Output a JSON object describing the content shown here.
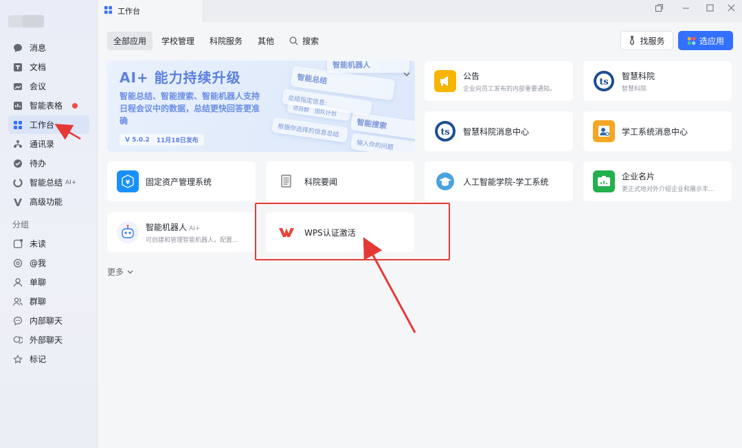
{
  "window": {
    "title": "工作台"
  },
  "sidebar": {
    "items": [
      {
        "label": "消息",
        "icon": "message-icon"
      },
      {
        "label": "文档",
        "icon": "doc-icon"
      },
      {
        "label": "会议",
        "icon": "meeting-icon"
      },
      {
        "label": "智能表格",
        "icon": "table-icon"
      },
      {
        "label": "工作台",
        "icon": "workbench-icon"
      },
      {
        "label": "通讯录",
        "icon": "contacts-icon"
      },
      {
        "label": "待办",
        "icon": "todo-icon"
      },
      {
        "label": "智能总结",
        "icon": "summary-icon",
        "badge": "AI+"
      },
      {
        "label": "高级功能",
        "icon": "advanced-icon"
      }
    ],
    "group_label": "分组",
    "groups": [
      {
        "label": "未读",
        "icon": "unread-icon"
      },
      {
        "label": "@我",
        "icon": "at-icon"
      },
      {
        "label": "单聊",
        "icon": "user-icon"
      },
      {
        "label": "群聊",
        "icon": "group-icon"
      },
      {
        "label": "内部聊天",
        "icon": "chat-icon"
      },
      {
        "label": "外部聊天",
        "icon": "external-chat-icon"
      },
      {
        "label": "标记",
        "icon": "star-icon"
      }
    ]
  },
  "tabs": [
    "全部应用",
    "学校管理",
    "科院服务",
    "其他"
  ],
  "search": {
    "label": "搜索"
  },
  "buttons": {
    "find_service": "找服务",
    "pick_app": "选应用"
  },
  "banner": {
    "title": "AI+ 能力持续升级",
    "desc": "智能总结、智能搜索、智能机器人支持日程会议中的数据，总结更快回答更准确",
    "version": "V 5.0.2",
    "date": "11月18日发布",
    "deco1": "智能机器人",
    "deco2": "智能总结",
    "deco3": "智能搜索",
    "deco4": "总结指定信息:",
    "deco5": "根据你选择的信息总结",
    "deco6": "输入你的问题",
    "deco7": "项目群",
    "deco8": "团队计划"
  },
  "apps": [
    {
      "name": "公告",
      "desc": "企业向员工发布的内部重要通知。",
      "icon": "megaphone-icon",
      "color": "#f7b500"
    },
    {
      "name": "智慧科院",
      "desc": "智慧科院",
      "icon": "school-logo-icon",
      "color": "#1d4f91"
    },
    {
      "name": "智慧科院消息中心",
      "icon": "school-logo-icon",
      "color": "#1d4f91"
    },
    {
      "name": "学工系统消息中心",
      "icon": "student-id-icon",
      "color": "#f5a623"
    },
    {
      "name": "固定资产管理系统",
      "icon": "asset-icon",
      "color": "#1890ff"
    },
    {
      "name": "科院要闻",
      "icon": "news-icon",
      "color": "#6b6b6b"
    },
    {
      "name": "人工智能学院-学工系统",
      "icon": "graduation-cap-icon",
      "color": "#4aa3df"
    },
    {
      "name": "企业名片",
      "desc": "更正式地对外介绍企业和展示丰...",
      "icon": "business-card-icon",
      "color": "#23b14d"
    },
    {
      "name": "智能机器人",
      "desc": "可创建和管理智能机器人，配置...",
      "icon": "robot-icon",
      "color": "#3370ff",
      "badge": "AI+"
    },
    {
      "name": "WPS认证激活",
      "icon": "wps-icon",
      "color": "#e94335"
    }
  ],
  "more": {
    "label": "更多"
  }
}
